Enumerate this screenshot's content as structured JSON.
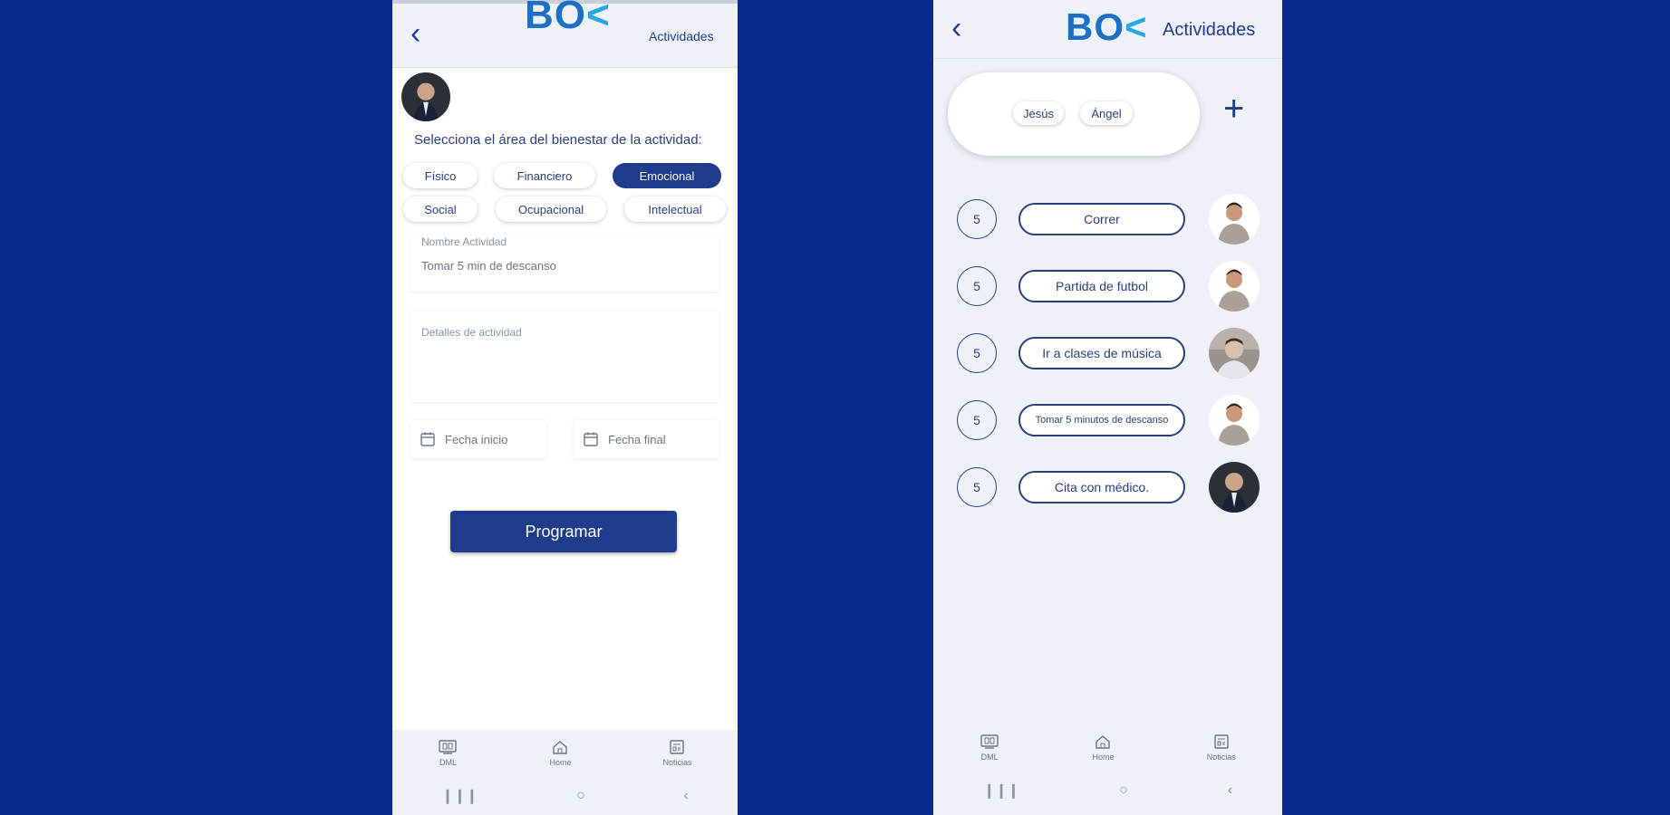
{
  "left": {
    "header": {
      "logo": "BO",
      "title": "Actividades"
    },
    "prompt": "Selecciona el área del bienestar de la actividad:",
    "categories": [
      {
        "label": "Físico",
        "selected": false
      },
      {
        "label": "Financiero",
        "selected": false
      },
      {
        "label": "Emocional",
        "selected": true
      },
      {
        "label": "Social",
        "selected": false
      },
      {
        "label": "Ocupacional",
        "selected": false
      },
      {
        "label": "Intelectual",
        "selected": false
      }
    ],
    "name_field": {
      "label": "Nombre Actividad",
      "value": "Tomar 5 min de descanso"
    },
    "details_field": {
      "label": "Detalles de actividad"
    },
    "start_date": {
      "placeholder": "Fecha inicio"
    },
    "end_date": {
      "placeholder": "Fecha final"
    },
    "program_button": "Programar",
    "nav": [
      {
        "label": "DML",
        "icon": "dml-icon"
      },
      {
        "label": "Home",
        "icon": "home-icon"
      },
      {
        "label": "Noticias",
        "icon": "news-icon"
      }
    ]
  },
  "right": {
    "header": {
      "logo": "BO",
      "title": "Actividades"
    },
    "people": [
      "Jesús",
      "Ángel"
    ],
    "add_symbol": "+",
    "activities": [
      {
        "count": "5",
        "label": "Correr",
        "avatar": "man"
      },
      {
        "count": "5",
        "label": "Partida de futbol",
        "avatar": "man"
      },
      {
        "count": "5",
        "label": "Ir a clases de música",
        "avatar": "photo"
      },
      {
        "count": "5",
        "label": "Tomar 5 minutos de descanso",
        "avatar": "man"
      },
      {
        "count": "5",
        "label": "Cita con médico.",
        "avatar": "suit"
      }
    ],
    "nav": [
      {
        "label": "DML",
        "icon": "dml-icon"
      },
      {
        "label": "Home",
        "icon": "home-icon"
      },
      {
        "label": "Noticias",
        "icon": "news-icon"
      }
    ]
  },
  "colors": {
    "background": "#0a2a8a",
    "primary": "#1f3c8c",
    "logo": "#1b6fc4",
    "accent": "#2aa6e0"
  }
}
